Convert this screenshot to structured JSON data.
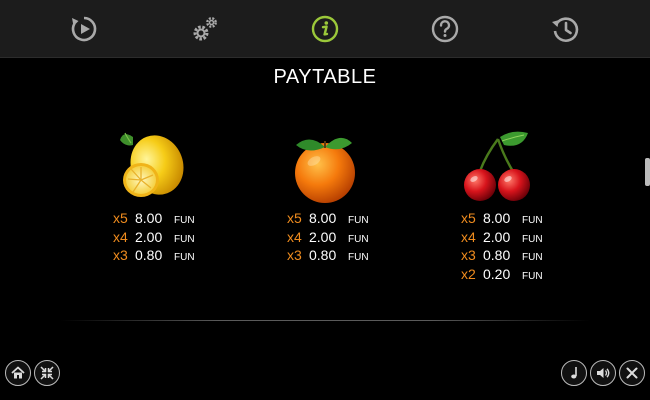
{
  "colors": {
    "accent_green": "#9bc83a",
    "icon_gray": "#a9a9a9",
    "multiplier_orange": "#f08c1e"
  },
  "topbar": {
    "buttons": [
      {
        "icon": "autoplay-icon"
      },
      {
        "icon": "settings-gears-icon"
      },
      {
        "icon": "info-icon",
        "active": true
      },
      {
        "icon": "help-icon"
      },
      {
        "icon": "history-icon"
      }
    ]
  },
  "title": "PAYTABLE",
  "symbols": [
    {
      "name": "lemon",
      "pays": [
        {
          "mult": "x5",
          "amount": "8.00",
          "currency": "FUN"
        },
        {
          "mult": "x4",
          "amount": "2.00",
          "currency": "FUN"
        },
        {
          "mult": "x3",
          "amount": "0.80",
          "currency": "FUN"
        }
      ]
    },
    {
      "name": "orange",
      "pays": [
        {
          "mult": "x5",
          "amount": "8.00",
          "currency": "FUN"
        },
        {
          "mult": "x4",
          "amount": "2.00",
          "currency": "FUN"
        },
        {
          "mult": "x3",
          "amount": "0.80",
          "currency": "FUN"
        }
      ]
    },
    {
      "name": "cherry",
      "pays": [
        {
          "mult": "x5",
          "amount": "8.00",
          "currency": "FUN"
        },
        {
          "mult": "x4",
          "amount": "2.00",
          "currency": "FUN"
        },
        {
          "mult": "x3",
          "amount": "0.80",
          "currency": "FUN"
        },
        {
          "mult": "x2",
          "amount": "0.20",
          "currency": "FUN"
        }
      ]
    }
  ],
  "bottom": {
    "left_buttons": [
      {
        "icon": "home-icon"
      },
      {
        "icon": "minimize-icon"
      }
    ],
    "right_buttons": [
      {
        "icon": "music-icon"
      },
      {
        "icon": "sound-icon"
      },
      {
        "icon": "close-icon"
      }
    ]
  }
}
